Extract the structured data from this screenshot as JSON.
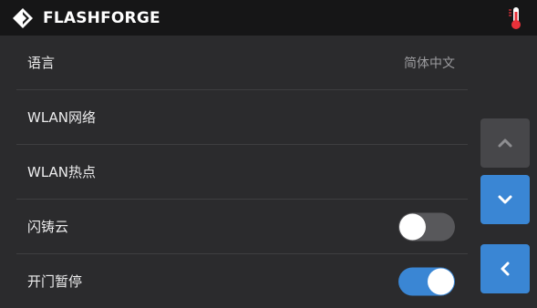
{
  "app": {
    "brand": "FLASHFORGE",
    "logo_icon": "flashforge-diamond-logo-icon",
    "status_icon": "thermometer-icon"
  },
  "colors": {
    "accent": "#3a86d4",
    "background": "#2b2b2d",
    "topbar": "#161617",
    "toggle_off": "#58585b",
    "disabled_button": "#47474a",
    "thermometer": "#e8313a"
  },
  "settings": {
    "rows": [
      {
        "label": "语言",
        "value": "简体中文"
      },
      {
        "label": "WLAN网络"
      },
      {
        "label": "WLAN热点"
      },
      {
        "label": "闪铸云",
        "toggle": "off"
      },
      {
        "label": "开门暂停",
        "toggle": "on"
      }
    ]
  },
  "nav": {
    "up_icon": "chevron-up-icon",
    "down_icon": "chevron-down-icon",
    "back_icon": "chevron-left-icon"
  }
}
